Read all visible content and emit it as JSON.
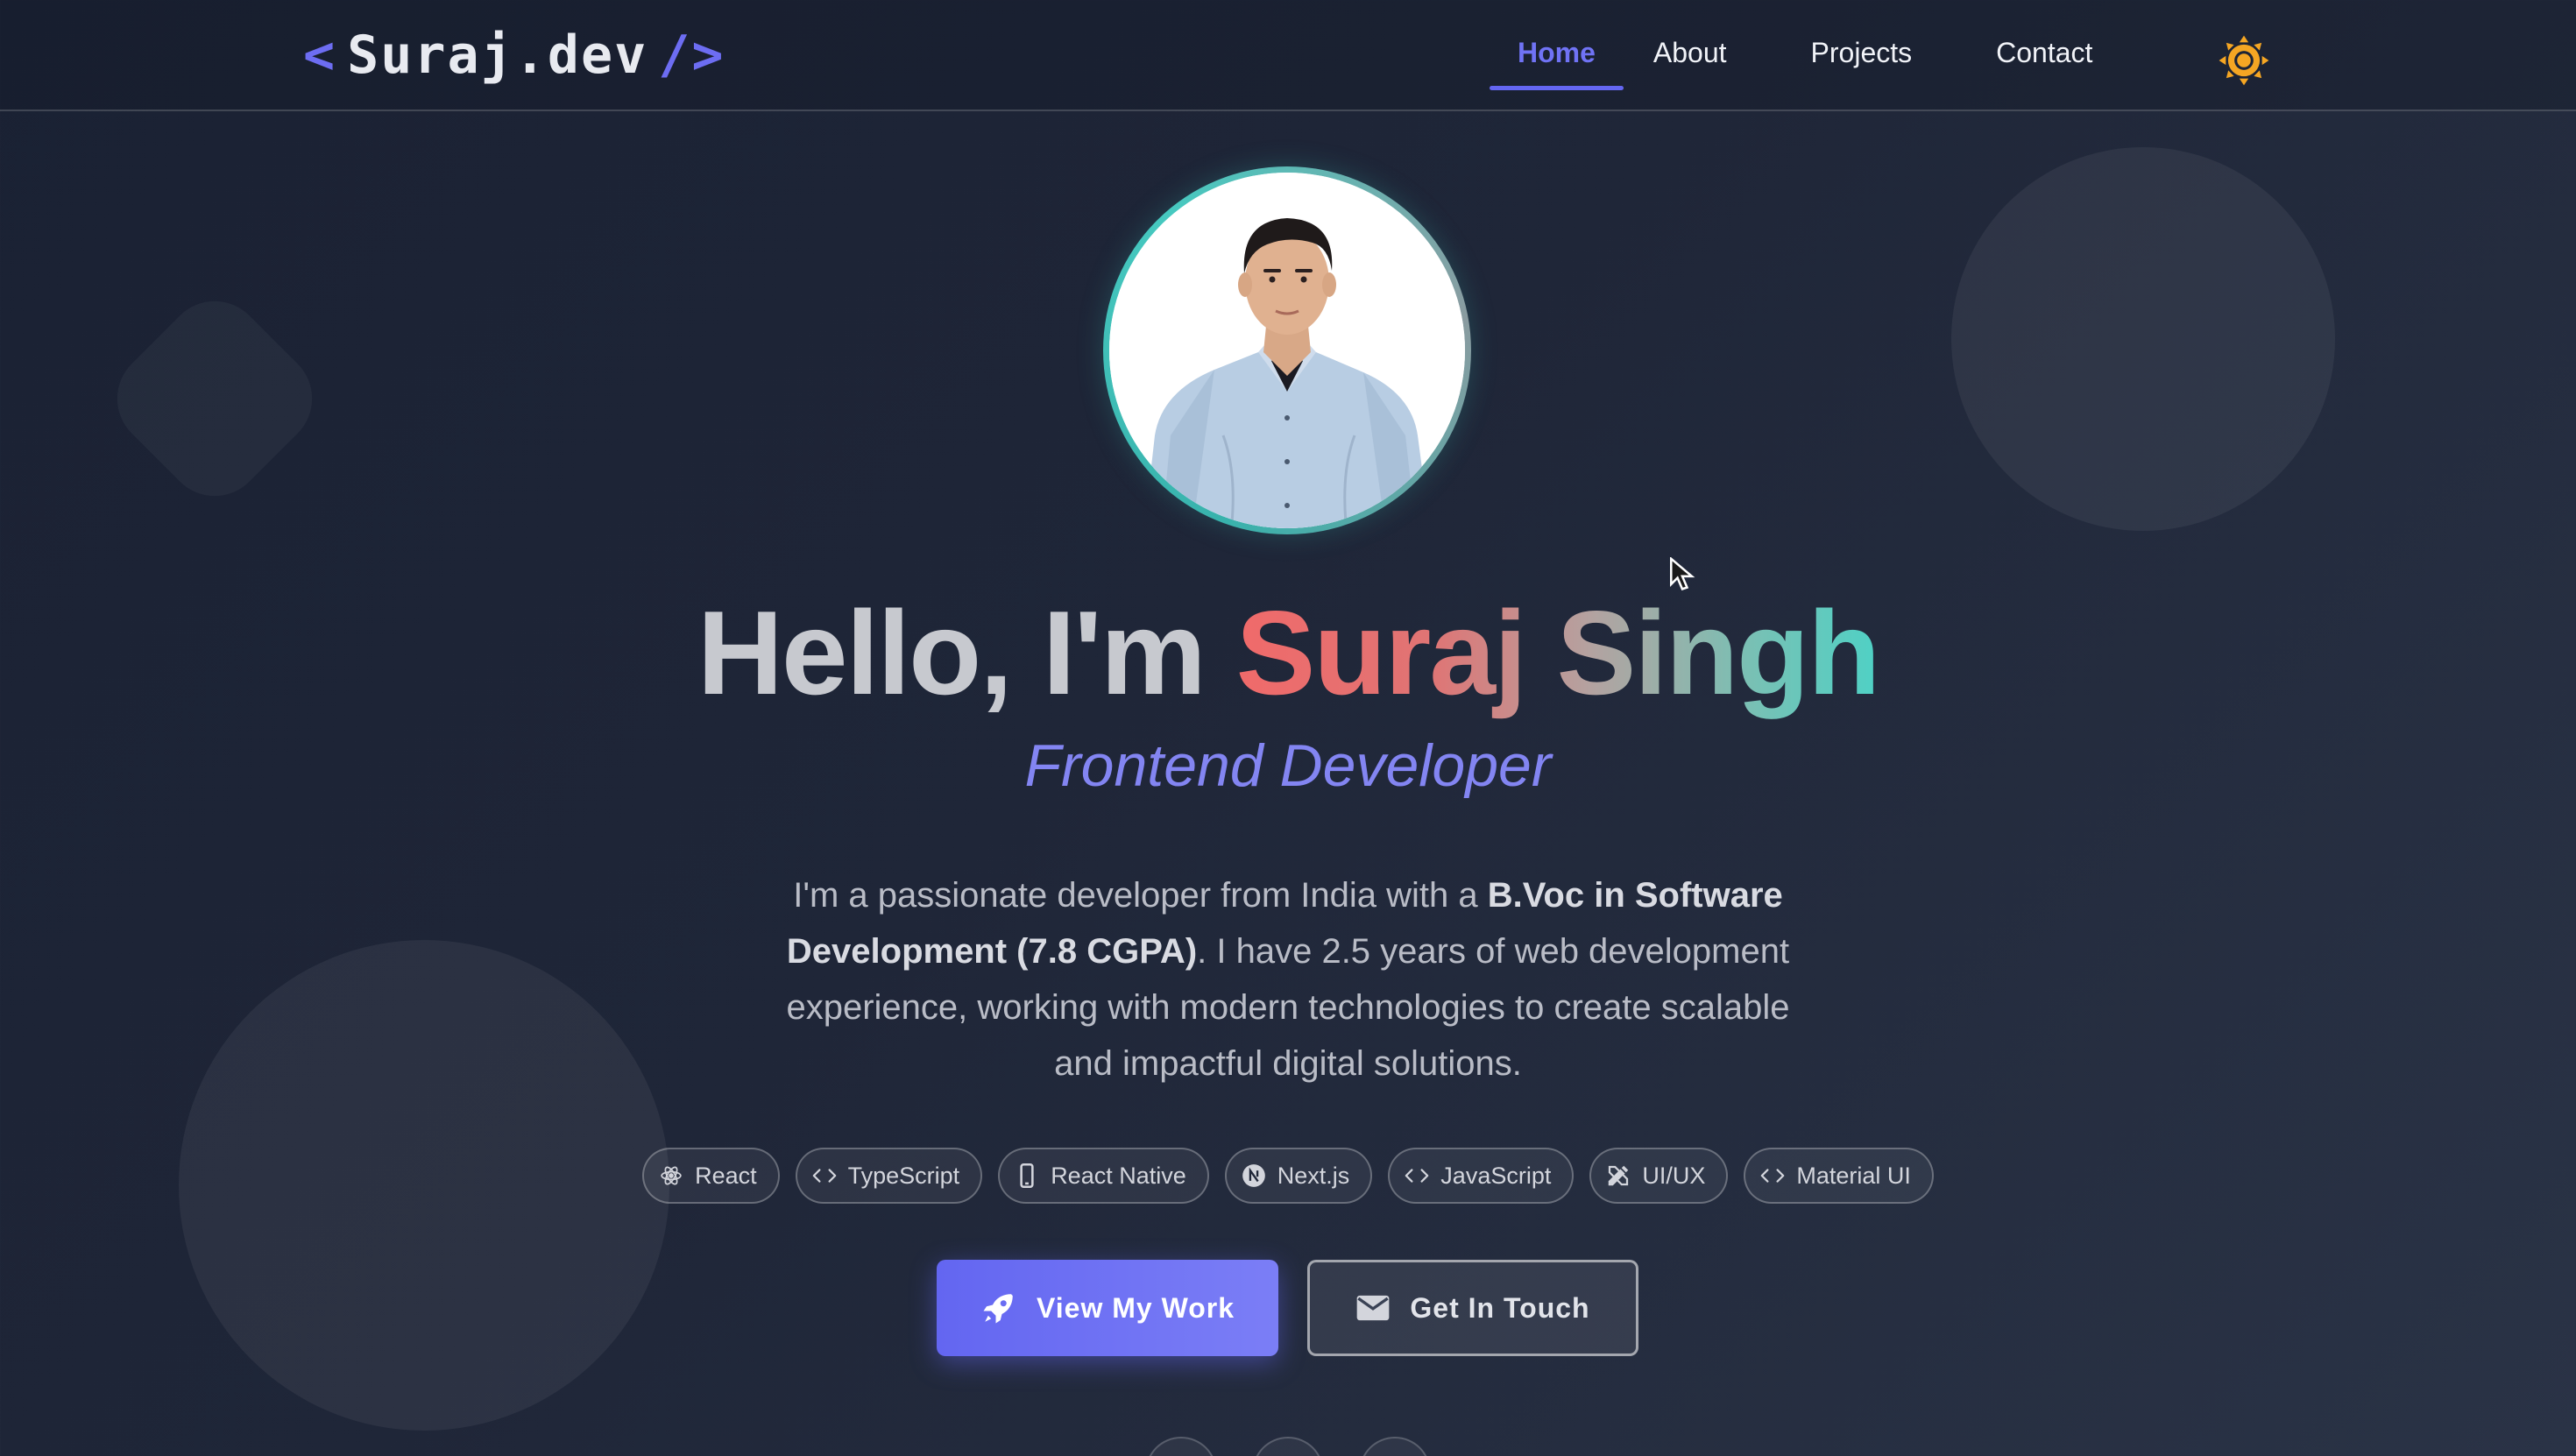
{
  "nav": {
    "logo": {
      "open": "<",
      "name": "Suraj.dev",
      "close": "/>"
    },
    "links": [
      {
        "label": "Home",
        "active": true
      },
      {
        "label": "About",
        "active": false
      },
      {
        "label": "Projects",
        "active": false
      },
      {
        "label": "Contact",
        "active": false
      }
    ],
    "theme_icon": "sun-icon"
  },
  "hero": {
    "avatar_icon": "profile-photo",
    "greeting": "Hello, I'm",
    "name": "Suraj Singh",
    "role": "Frontend Developer",
    "bio": {
      "part1": "I'm a passionate developer from India with a ",
      "bold": "B.Voc in Software Development (7.8 CGPA)",
      "part2": ". I have 2.5 years of web development experience, working with modern technologies to create scalable and impactful digital solutions."
    },
    "skills": [
      {
        "label": "React",
        "icon": "atom-icon"
      },
      {
        "label": "TypeScript",
        "icon": "code-icon"
      },
      {
        "label": "React Native",
        "icon": "phone-icon"
      },
      {
        "label": "Next.js",
        "icon": "nextjs-icon"
      },
      {
        "label": "JavaScript",
        "icon": "code-icon"
      },
      {
        "label": "UI/UX",
        "icon": "design-tools-icon"
      },
      {
        "label": "Material UI",
        "icon": "code-icon"
      }
    ],
    "primary_cta": {
      "label": "View My Work",
      "icon": "rocket-icon"
    },
    "secondary_cta": {
      "label": "Get In Touch",
      "icon": "mail-icon"
    }
  },
  "colors": {
    "accent": "#6366f1",
    "teal": "#4fd1c5",
    "coral": "#f06a6a",
    "sun": "#f5a623"
  }
}
